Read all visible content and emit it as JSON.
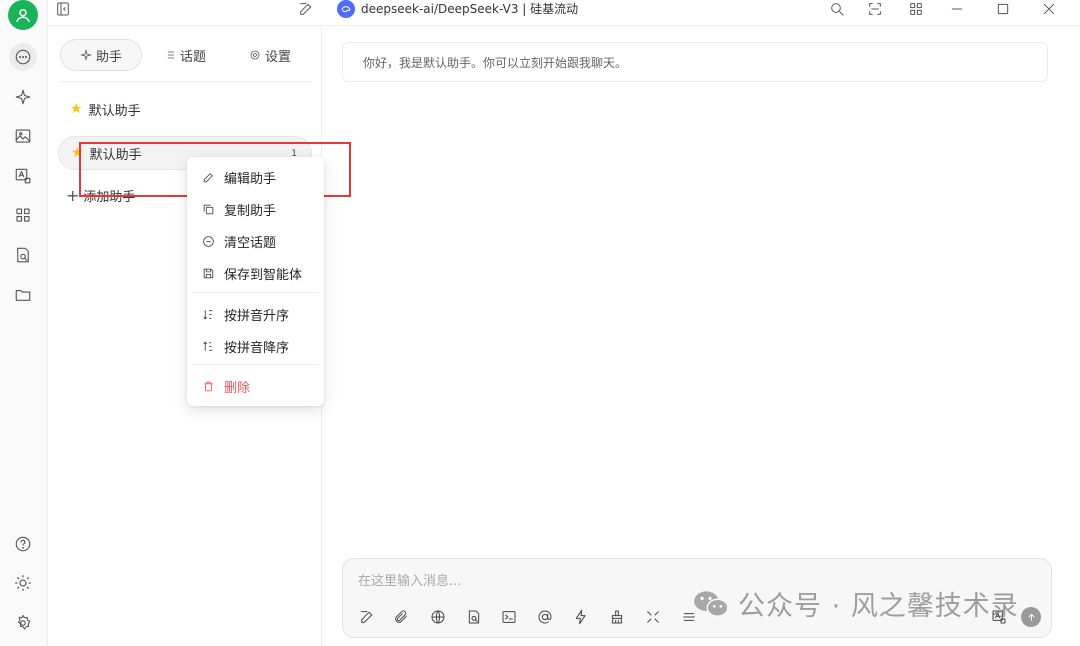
{
  "titlebar": {
    "model_name": "deepseek-ai/DeepSeek-V3 | 硅基流动"
  },
  "tabs": [
    {
      "label": "助手",
      "icon": "sparkle-icon",
      "active": true
    },
    {
      "label": "话题",
      "icon": "list-icon",
      "active": false
    },
    {
      "label": "设置",
      "icon": "gear-icon",
      "active": false
    }
  ],
  "assistants": [
    {
      "name": "默认助手",
      "icon": "star-icon",
      "selected": false
    },
    {
      "name": "默认助手",
      "icon": "star-icon",
      "selected": true,
      "topic_count": "1"
    }
  ],
  "add_assistant_label": "添加助手",
  "context_menu": {
    "edit": "编辑助手",
    "copy": "复制助手",
    "clear": "清空话题",
    "save": "保存到智能体",
    "sort_asc": "按拼音升序",
    "sort_desc": "按拼音降序",
    "delete": "删除"
  },
  "chat": {
    "welcome_message": "你好，我是默认助手。你可以立刻开始跟我聊天。"
  },
  "composer": {
    "placeholder": "在这里输入消息..."
  },
  "watermark": {
    "text": "公众号 · 风之馨技术录"
  },
  "colors": {
    "avatar": "#19b35a",
    "highlight": "#e23a3a",
    "danger": "#ff4d4f",
    "star": "#f5c518",
    "model_logo": "#4d6bfe"
  }
}
